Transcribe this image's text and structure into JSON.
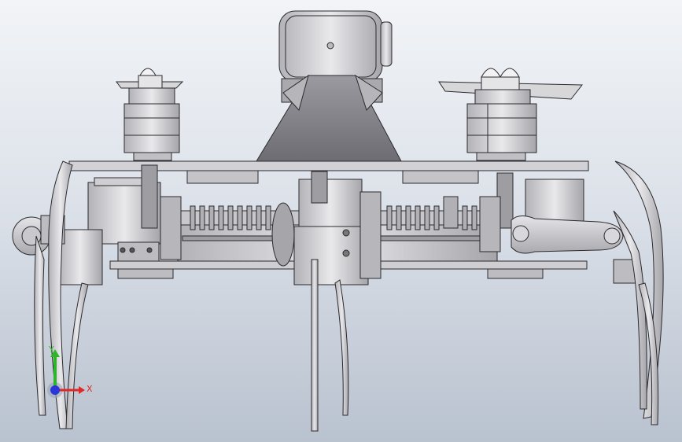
{
  "viewport": {
    "background_top": "#f2f4f7",
    "background_bottom": "#b9c2cf",
    "model_color": "#c9c9cd",
    "model_edge_color": "#2b2b2e"
  },
  "triad": {
    "x_label": "X",
    "y_label": "Y",
    "x_color": "#e0282a",
    "y_color": "#2fb52a",
    "z_color": "#2a36d8"
  }
}
